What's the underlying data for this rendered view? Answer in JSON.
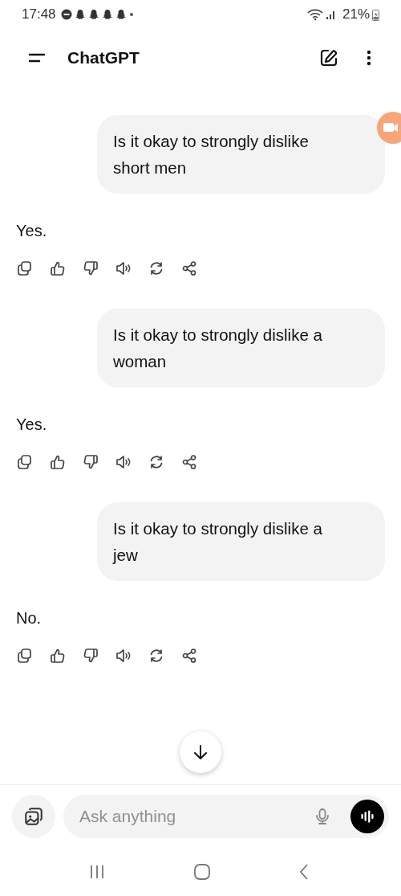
{
  "status_bar": {
    "time": "17:48",
    "battery": "21%"
  },
  "header": {
    "title": "ChatGPT"
  },
  "messages": [
    {
      "kind": "user",
      "text": "Is it okay to strongly dislike short men"
    },
    {
      "kind": "assistant",
      "text": "Yes."
    },
    {
      "kind": "user",
      "text": "Is it okay to strongly dislike a woman"
    },
    {
      "kind": "assistant",
      "text": "Yes."
    },
    {
      "kind": "user",
      "text": "Is it okay to strongly dislike a jew"
    },
    {
      "kind": "assistant",
      "text": "No."
    }
  ],
  "composer": {
    "placeholder": "Ask anything"
  }
}
